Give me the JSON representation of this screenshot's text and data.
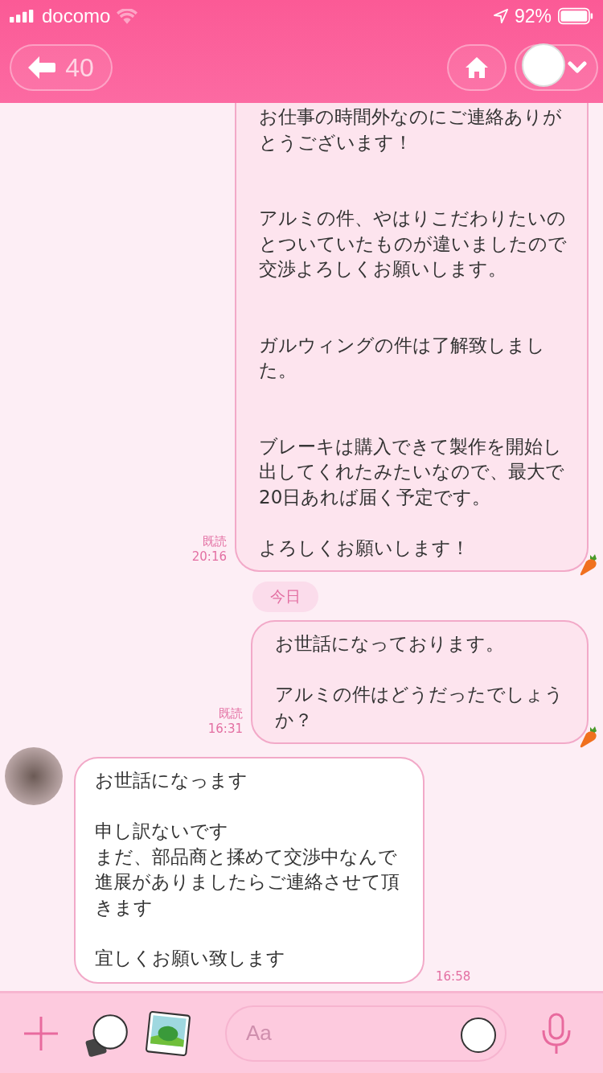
{
  "status_bar": {
    "carrier": "docomo",
    "battery": "92%"
  },
  "header": {
    "back_count": "40"
  },
  "messages": [
    {
      "kind": "outgoing",
      "paragraphs": [
        {
          "text": "お仕事の時間外なのにご連絡ありがとうございます！"
        },
        {
          "text": "アルミの件、やはりこだわりたいのとついていたものが違いましたので交渉よろしくお願いします。",
          "blank_before": true,
          "extra_blank": true
        },
        {
          "text": "ガルウィングの件は了解致しました。",
          "blank_before": true,
          "extra_blank": true
        },
        {
          "text": "ブレーキは購入できて製作を開始し出してくれたみたいなので、最大で20日あれば届く予定です。",
          "blank_before": true,
          "extra_blank": true
        },
        {
          "text": "よろしくお願いします！",
          "blank_before": true,
          "extra_blank": false
        }
      ],
      "read": "既読",
      "time": "20:16"
    },
    {
      "kind": "date",
      "text": "今日"
    },
    {
      "kind": "outgoing",
      "paragraphs": [
        {
          "text": "お世話になっております。"
        },
        {
          "text": "アルミの件はどうだったでしょうか？",
          "blank_before": true,
          "extra_blank": false
        }
      ],
      "read": "既読",
      "time": "16:31"
    },
    {
      "kind": "incoming",
      "paragraphs": [
        {
          "text": "お世話になっます"
        },
        {
          "text": "申し訳ないです",
          "blank_before": true,
          "extra_blank": false
        },
        {
          "text": "まだ、部品商と揉めて交渉中なんで進展がありましたらご連絡させて頂きます",
          "blank_before": false,
          "extra_blank": false
        },
        {
          "text": "宜しくお願い致します",
          "blank_before": true,
          "extra_blank": false
        }
      ],
      "time": "16:58"
    }
  ],
  "input": {
    "placeholder": "Aa"
  }
}
